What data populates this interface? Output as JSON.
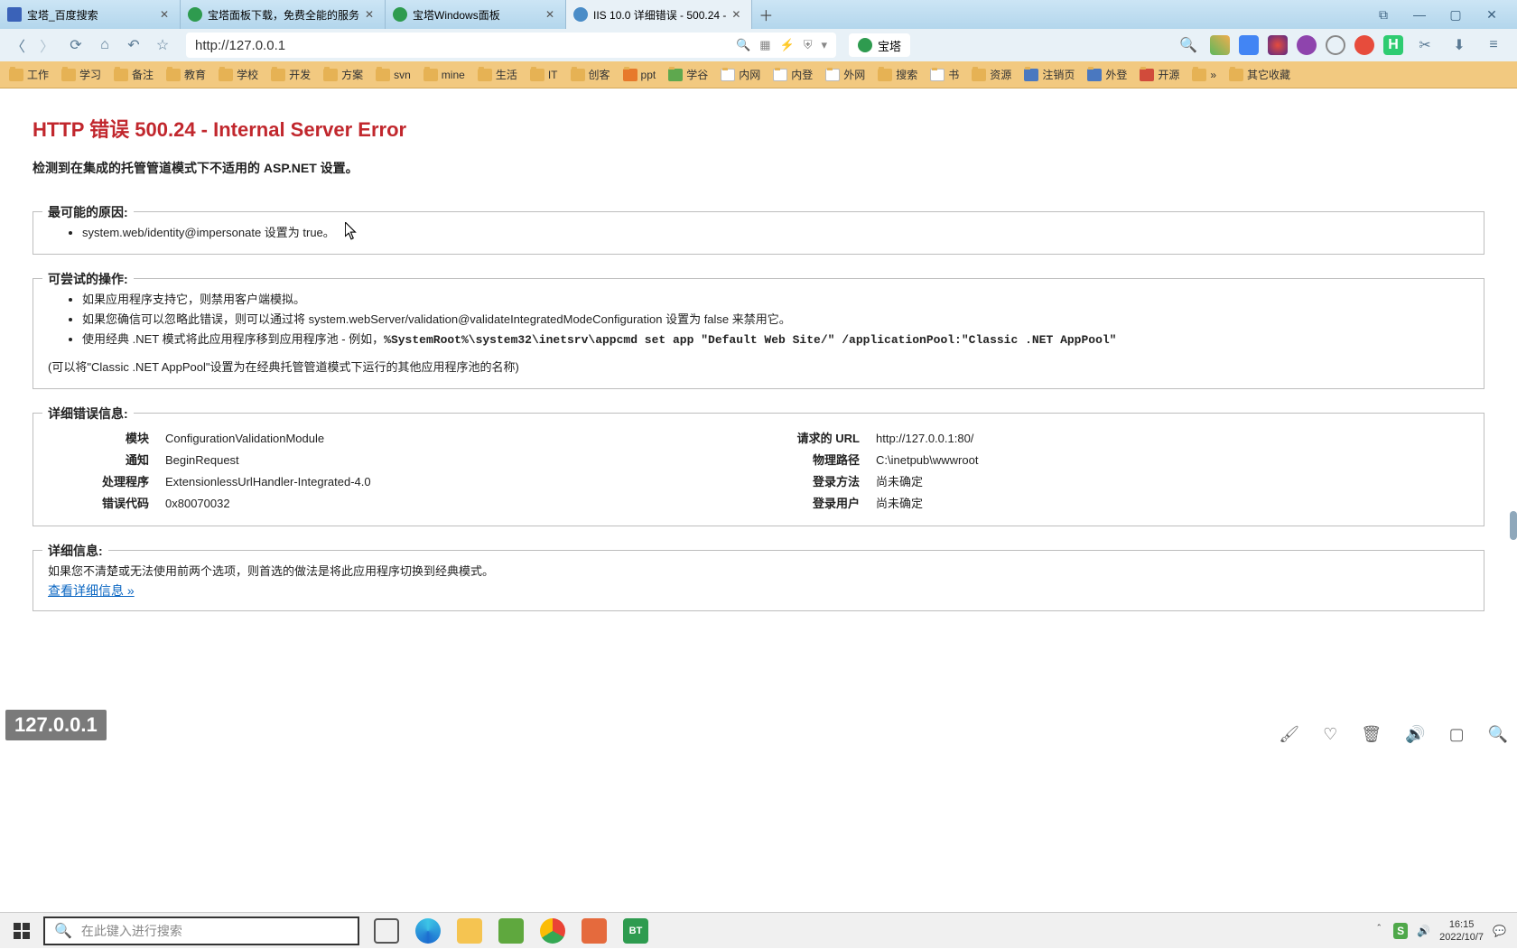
{
  "tabs": [
    {
      "title": "宝塔_百度搜索",
      "active": false,
      "favicon": "#3a62b8"
    },
    {
      "title": "宝塔面板下载，免费全能的服务",
      "active": false,
      "favicon": "#2e9b4f"
    },
    {
      "title": "宝塔Windows面板",
      "active": false,
      "favicon": "#2e9b4f"
    },
    {
      "title": "IIS 10.0 详细错误 - 500.24 -",
      "active": true,
      "favicon": "#4a8cc7"
    }
  ],
  "url": "http://127.0.0.1",
  "searchLabel": "宝塔",
  "bookmarks": [
    {
      "label": "工作"
    },
    {
      "label": "学习"
    },
    {
      "label": "备注"
    },
    {
      "label": "教育"
    },
    {
      "label": "学校"
    },
    {
      "label": "开发"
    },
    {
      "label": "方案"
    },
    {
      "label": "svn"
    },
    {
      "label": "mine"
    },
    {
      "label": "生活"
    },
    {
      "label": "IT"
    },
    {
      "label": "创客"
    },
    {
      "label": "ppt",
      "cls": "orange"
    },
    {
      "label": "学谷",
      "cls": "green"
    },
    {
      "label": "内网",
      "cls": "alt"
    },
    {
      "label": "内登",
      "cls": "alt"
    },
    {
      "label": "外网",
      "cls": "alt"
    },
    {
      "label": "搜索"
    },
    {
      "label": "书",
      "cls": "alt"
    },
    {
      "label": "资源"
    },
    {
      "label": "注销页",
      "cls": "blue"
    },
    {
      "label": "外登",
      "cls": "blue"
    },
    {
      "label": "开源",
      "cls": "red"
    },
    {
      "label": "»"
    },
    {
      "label": "其它收藏"
    }
  ],
  "page": {
    "h1": "HTTP 错误 500.24 - Internal Server Error",
    "h2": "检测到在集成的托管管道模式下不适用的 ASP.NET 设置。",
    "sec1_title": "最可能的原因:",
    "sec1_items": [
      "system.web/identity@impersonate 设置为 true。"
    ],
    "sec2_title": "可尝试的操作:",
    "sec2_items": [
      "如果应用程序支持它，则禁用客户端模拟。",
      "如果您确信可以忽略此错误，则可以通过将 system.webServer/validation@validateIntegratedModeConfiguration 设置为 false 来禁用它。"
    ],
    "sec2_item3_prefix": "使用经典 .NET 模式将此应用程序移到应用程序池 - 例如，",
    "sec2_item3_cmd": "%SystemRoot%\\system32\\inetsrv\\appcmd set app \"Default Web Site/\" /applicationPool:\"Classic .NET AppPool\"",
    "sec2_hint": "(可以将\"Classic .NET AppPool\"设置为在经典托管管道模式下运行的其他应用程序池的名称)",
    "sec3_title": "详细错误信息:",
    "detailsLeft": [
      {
        "k": "模块",
        "v": "ConfigurationValidationModule"
      },
      {
        "k": "通知",
        "v": "BeginRequest"
      },
      {
        "k": "处理程序",
        "v": "ExtensionlessUrlHandler-Integrated-4.0"
      },
      {
        "k": "错误代码",
        "v": "0x80070032"
      }
    ],
    "detailsRight": [
      {
        "k": "请求的 URL",
        "v": "http://127.0.0.1:80/"
      },
      {
        "k": "物理路径",
        "v": "C:\\inetpub\\wwwroot"
      },
      {
        "k": "登录方法",
        "v": "尚未确定"
      },
      {
        "k": "登录用户",
        "v": "尚未确定"
      }
    ],
    "sec4_title": "详细信息:",
    "sec4_text": "如果您不清楚或无法使用前两个选项，则首选的做法是将此应用程序切换到经典模式。",
    "sec4_link": "查看详细信息 »"
  },
  "url_overlay": "127.0.0.1",
  "taskbar": {
    "searchPlaceholder": "在此键入进行搜索",
    "time": "16:15",
    "date": "2022/10/7"
  }
}
